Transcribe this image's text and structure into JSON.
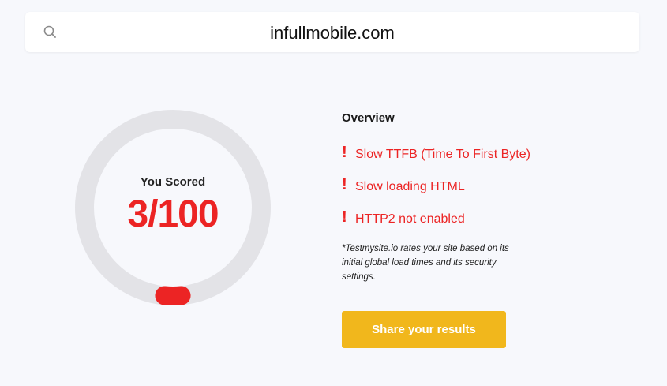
{
  "search": {
    "value": "infullmobile.com",
    "icon": "search-icon"
  },
  "score": {
    "label": "You Scored",
    "display": "3/100",
    "value": 3,
    "max": 100,
    "ring_color": "#e3e3e7",
    "indicator_color": "#ec2424"
  },
  "overview": {
    "title": "Overview",
    "issue_marker": "!",
    "issues": [
      "Slow TTFB (Time To First Byte)",
      "Slow loading HTML",
      "HTTP2 not enabled"
    ],
    "note": "*Testmysite.io rates your site based on its initial global load times and its security settings."
  },
  "share_button": {
    "label": "Share your results",
    "color": "#f1b71c"
  }
}
